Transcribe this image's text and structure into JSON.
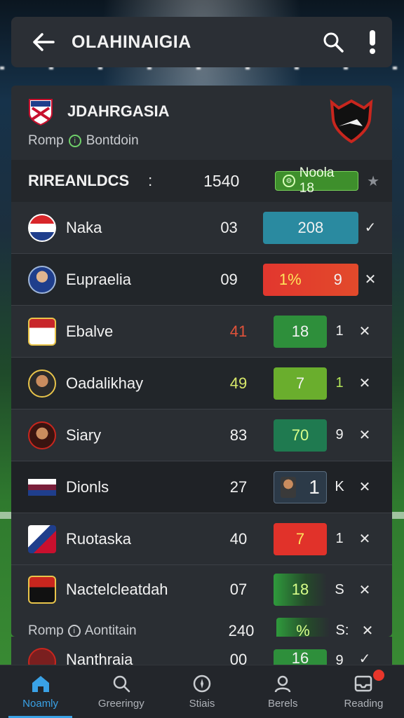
{
  "header": {
    "title": "OLAHINAIGIA"
  },
  "team": {
    "name": "JDAHRGASIA",
    "sub_prefix": "Romp",
    "sub_text": "Bontdoin"
  },
  "summary": {
    "label": "RIREANLDCS",
    "colon": ":",
    "value": "1540",
    "badge": "Noola 18"
  },
  "rows": [
    {
      "name": "Naka",
      "score": "03",
      "pill": "208",
      "extra": "",
      "ctrl": "✓"
    },
    {
      "name": "Eupraelia",
      "score": "09",
      "pill": "1%",
      "extra": "9",
      "ctrl": "✕"
    },
    {
      "name": "Ebalve",
      "score": "41",
      "pill": "18",
      "extra": "1",
      "ctrl": "✕"
    },
    {
      "name": "Oadalikhay",
      "score": "49",
      "pill": "7",
      "extra": "1",
      "ctrl": "✕"
    },
    {
      "name": "Siary",
      "score": "83",
      "pill": "70",
      "extra": "9",
      "ctrl": "✕"
    },
    {
      "name": "Dionls",
      "score": "27",
      "pill": "1",
      "extra": "K",
      "ctrl": "✕"
    },
    {
      "name": "Ruotaska",
      "score": "40",
      "pill": "7",
      "extra": "1",
      "ctrl": "✕"
    },
    {
      "name": "Nactelcleatdah",
      "score": "07",
      "pill": "18",
      "extra": "S",
      "ctrl": "✕"
    },
    {
      "name": "",
      "score": "240",
      "pill": "%",
      "extra": "S:",
      "ctrl": "✕",
      "sub_prefix": "Romp",
      "sub_text": "Aontitain"
    },
    {
      "name": "Nanthraia",
      "score": "00",
      "pill": "16",
      "extra": "9",
      "ctrl": "✓"
    }
  ],
  "nav": [
    {
      "label": "Noamly",
      "icon": "home-icon"
    },
    {
      "label": "Greeringy",
      "icon": "search-icon"
    },
    {
      "label": "Stiais",
      "icon": "compass-icon"
    },
    {
      "label": "Berels",
      "icon": "user-icon"
    },
    {
      "label": "Reading",
      "icon": "inbox-icon"
    }
  ],
  "colors": {
    "accent": "#3aa2e6",
    "green_badge": "#3e8f2c",
    "red": "#e2372e",
    "blue_pill": "#2a8aa0"
  }
}
